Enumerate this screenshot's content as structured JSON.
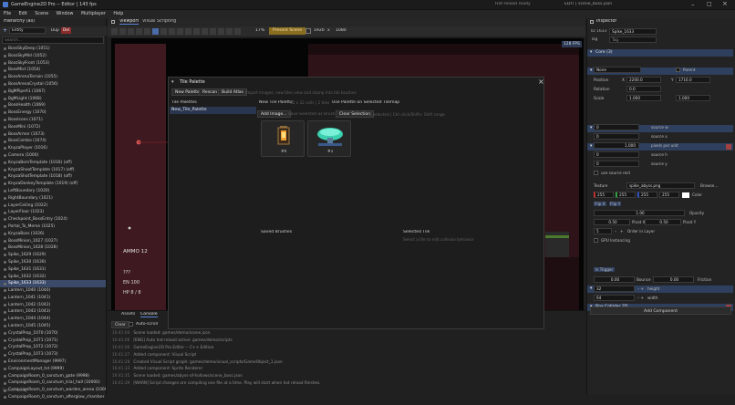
{
  "titlebar": {
    "title": "GameEngine2D Pro -- Editor | 143 fps",
    "status": "Hot-reload ready",
    "project": "EDIT | scene_boss.json"
  },
  "menu": [
    "File",
    "Edit",
    "Scene",
    "Window",
    "Multiplayer",
    "Help"
  ],
  "hierarchy": {
    "title": "Hierarchy (all)",
    "buttons": [
      "Entity",
      "Dup",
      "Del"
    ],
    "search_placeholder": "Search...",
    "items": [
      {
        "label": "BossSkyDeep (1051)",
        "sel": false
      },
      {
        "label": "BossSkyMid (1052)",
        "sel": false
      },
      {
        "label": "BossSkyFront (1053)",
        "sel": false
      },
      {
        "label": "BossMist (1054)",
        "sel": false
      },
      {
        "label": "BossArenaTerrain (1055)",
        "sel": false
      },
      {
        "label": "BossArenaCrystal (1056)",
        "sel": false
      },
      {
        "label": "BgMPipeA1 (1067)",
        "sel": false
      },
      {
        "label": "BgMLight (1068)",
        "sel": false
      },
      {
        "label": "BossHealth (1069)",
        "sel": false
      },
      {
        "label": "BossEnergy (1070)",
        "sel": false
      },
      {
        "label": "BossIcons (1071)",
        "sel": false
      },
      {
        "label": "BossMini (1072)",
        "sel": false
      },
      {
        "label": "BossArmor (1073)",
        "sel": false
      },
      {
        "label": "BossCombo (1074)",
        "sel": false
      },
      {
        "label": "KnyzaPlayer (1016)",
        "sel": false
      },
      {
        "label": "Camera (1000)",
        "sel": false
      },
      {
        "label": "KnyzaBomTemplate (1016) (off)",
        "sel": false
      },
      {
        "label": "KnyzaShootTemplate (1017) (off)",
        "sel": false
      },
      {
        "label": "KnyzaShotTemplate (1018) (off)",
        "sel": false
      },
      {
        "label": "KnyzaDonkeyTemplate (1019) (off)",
        "sel": false
      },
      {
        "label": "LeftBoundary (1020)",
        "sel": false
      },
      {
        "label": "RightBoundary (1021)",
        "sel": false
      },
      {
        "label": "LayerCeiling (1022)",
        "sel": false
      },
      {
        "label": "LayerFloor (1023)",
        "sel": false
      },
      {
        "label": "Checkpoint_BossEntry (1024)",
        "sel": false
      },
      {
        "label": "Portal_To_Meme (1025)",
        "sel": false
      },
      {
        "label": "KnyzaBoss (1026)",
        "sel": false
      },
      {
        "label": "BossMinion_1027 (1027)",
        "sel": false
      },
      {
        "label": "BossMinion_1028 (1028)",
        "sel": false
      },
      {
        "label": "Spike_1629 (1629)",
        "sel": false
      },
      {
        "label": "Spike_1630 (1630)",
        "sel": false
      },
      {
        "label": "Spike_1631 (1631)",
        "sel": false
      },
      {
        "label": "Spike_1632 (1632)",
        "sel": false
      },
      {
        "label": "Spike_1633 (1633)",
        "sel": true
      },
      {
        "label": "Lantern_1040 (1040)",
        "sel": false
      },
      {
        "label": "Lantern_1041 (1041)",
        "sel": false
      },
      {
        "label": "Lantern_1042 (1042)",
        "sel": false
      },
      {
        "label": "Lantern_1043 (1043)",
        "sel": false
      },
      {
        "label": "Lantern_1044 (1044)",
        "sel": false
      },
      {
        "label": "Lantern_1045 (1045)",
        "sel": false
      },
      {
        "label": "CrystalProp_1070 (1070)",
        "sel": false
      },
      {
        "label": "CrystalProp_1071 (1071)",
        "sel": false
      },
      {
        "label": "CrystalProp_1072 (1072)",
        "sel": false
      },
      {
        "label": "CrystalProp_1073 (1073)",
        "sel": false
      },
      {
        "label": "EnvironmentManager (9997)",
        "sel": false
      },
      {
        "label": "CampaignLayout_hd (9999)",
        "sel": false
      },
      {
        "label": "CampaignRoom_0_sanctum_gate (9998)",
        "sel": false
      },
      {
        "label": "CampaignRoom_0_sanctum_trial_hall (10000)",
        "sel": false
      },
      {
        "label": "CampaignRoom_0_sanctum_warden_arena (10001)",
        "sel": false
      },
      {
        "label": "CampaignRoom_0_sanctum_afterglow_chamber (10002)",
        "sel": false
      }
    ],
    "footer": "Scene Ready"
  },
  "scene": {
    "tabs": [
      "Viewport",
      "Visual Scripting"
    ],
    "zoom": "17%",
    "mode": "Present Scene",
    "res_w": "1920",
    "res_x": "x",
    "res_h": "1080",
    "fps_badge": "128 FPS",
    "hud": {
      "ammo": "AMMO 12",
      "q": "???",
      "en": "EN 100",
      "hp": "HP 8 / 8"
    }
  },
  "palette": {
    "title": "Tile Palette",
    "toolbar": [
      "New Palette",
      "Rescan",
      "Build Atlas"
    ],
    "toolbar_hint": "Import images, new tiles view and stamp into tile brushes",
    "list_header": "Tile Palettes",
    "palettes": [
      "New_Tile_Palette"
    ],
    "palette_name": "New Tile Palette",
    "palette_meta": "32 x 32 cells | 2 tiles",
    "use_button": "Use Palette on Selected Tilemap",
    "actions": [
      "Add Image...",
      "Save Selected as Brush",
      "Clear Selection"
    ],
    "actions_hint": "0 selected | Ctrl-click/Shift+ Shift range",
    "tiles": [
      {
        "id": "#0",
        "icon": "lantern-tile-icon"
      },
      {
        "id": "#1",
        "icon": "mushroom-tile-icon"
      }
    ],
    "saved_brushes": "Saved Brushes",
    "selected_tile": "Selected Tile",
    "selected_hint": "Select a tile to edit collision behavior"
  },
  "assets": {
    "tabs": [
      "Assets",
      "Console"
    ],
    "buttons": [
      "Clear"
    ],
    "autoscroll": "Auto-scroll",
    "log": [
      {
        "ts": "16:41:04",
        "msg": "Scene loaded: games/demo/scene.json"
      },
      {
        "ts": "16:41:06",
        "msg": "[ENG] Auto hot-reload active: games/demo/scripts"
      },
      {
        "ts": "16:41:06",
        "msg": "GameEngine2D Pro Editor -- C++ Edition"
      },
      {
        "ts": "16:41:27",
        "msg": "Added component: Visual Script"
      },
      {
        "ts": "16:41:28",
        "msg": "Created Visual Script graph: games/demo/visual_scripts/GameObject_1.json"
      },
      {
        "ts": "16:41:33",
        "msg": "Added component: Sprite Renderer"
      },
      {
        "ts": "16:41:35",
        "msg": "Scene loaded: games/abyss-of-hollows/scene_boss.json"
      },
      {
        "ts": "16:41:39",
        "msg": "[WARN] Script changes are compiling one file at a time. Play will start when hot reload finishes."
      }
    ]
  },
  "inspector": {
    "title": "Inspector",
    "id_label": "ID 1633",
    "name": "Spike_1633",
    "tag_label": "Tag",
    "tag_value": "Tag",
    "core": "Core (3)",
    "transform": "Transform",
    "parent_value": "None",
    "parent_btn": "Parent",
    "pos_label": "Position",
    "pos_x": "2200.0",
    "pos_y": "1716.0",
    "rot_label": "Rotation",
    "rot": "0.0",
    "scale_label": "Scale",
    "scale_x": "1.000",
    "scale_y": "1.000",
    "rendering": "Rendering (1)",
    "sprite_renderer": "Sprite Renderer",
    "source_w": "source w",
    "source_x": "source x",
    "source_h": "source h",
    "source_y": "source y",
    "ppu": "1.000",
    "ppu_label": "pixels per unit",
    "use_source": "use source rect",
    "texture_label": "Texture",
    "texture_value": "spike_abyss.png",
    "browse": "Browse...",
    "color_vals": [
      "255",
      "255",
      "255",
      "255"
    ],
    "color_label": "Color",
    "flip_x": "Flip X",
    "flip_y": "Flip Y",
    "opacity": "1.00",
    "opacity_label": "Opacity",
    "pivot_x": "0.50",
    "pivot_x_label": "Pivot X",
    "pivot_y": "0.50",
    "pivot_y_label": "Pivot Y",
    "order": "5",
    "order_label": "Order in Layer",
    "gpu": "GPU Instancing",
    "physics": "Physics 2D (1)",
    "collider": "Box Collider 2D",
    "is_trigger": "Is Trigger",
    "bounce": "0.00",
    "bounce_label": "Bounce",
    "friction": "0.00",
    "friction_label": "Friction",
    "height": "32",
    "height_label": "height",
    "width": "64",
    "width_label": "width",
    "add_component": "Add Component"
  }
}
